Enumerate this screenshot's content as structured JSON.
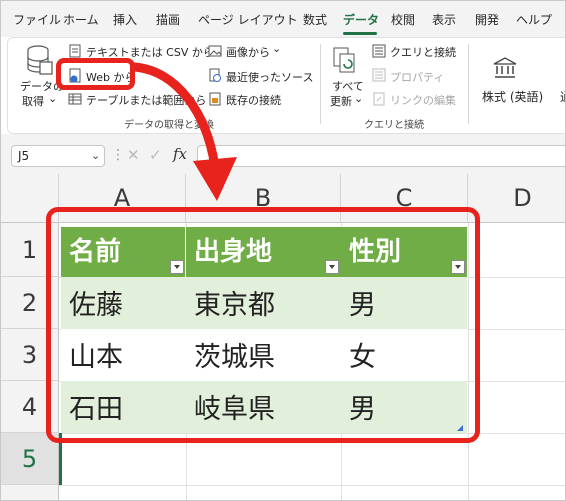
{
  "menu": {
    "tabs": [
      "ファイル",
      "ホーム",
      "挿入",
      "描画",
      "ページ レイアウト",
      "数式",
      "データ",
      "校閲",
      "表示",
      "開発",
      "ヘルプ"
    ],
    "active_tab": "データ"
  },
  "ribbon": {
    "get_data": {
      "label_line1": "データの",
      "label_line2": "取得",
      "chevron": "⌄"
    },
    "from_text_csv": "テキストまたは CSV から",
    "from_web": "Web から",
    "from_table_range": "テーブルまたは範囲から",
    "from_picture": "画像から",
    "recent_sources": "最近使ったソース",
    "existing_connections": "既存の接続",
    "group_get_transform": "データの取得と変換",
    "refresh_all": {
      "line1": "すべて",
      "line2": "更新"
    },
    "queries_connections": "クエリと接続",
    "properties": "プロパティ",
    "edit_links": "リンクの編集",
    "group_queries": "クエリと接続",
    "stocks": "株式 (英語)",
    "next_partial": "通"
  },
  "formula_bar": {
    "name_box": "J5",
    "fx": "fx"
  },
  "grid": {
    "columns": [
      "A",
      "B",
      "C",
      "D"
    ],
    "rows": [
      "1",
      "2",
      "3",
      "4",
      "5"
    ]
  },
  "table": {
    "headers": [
      "名前",
      "出身地",
      "性別"
    ],
    "rows": [
      [
        "佐藤",
        "東京都",
        "男"
      ],
      [
        "山本",
        "茨城県",
        "女"
      ],
      [
        "石田",
        "岐阜県",
        "男"
      ]
    ]
  },
  "colors": {
    "accent": "#217346",
    "table_header": "#70ad47",
    "band": "#e2efda",
    "highlight": "#e8221d"
  }
}
